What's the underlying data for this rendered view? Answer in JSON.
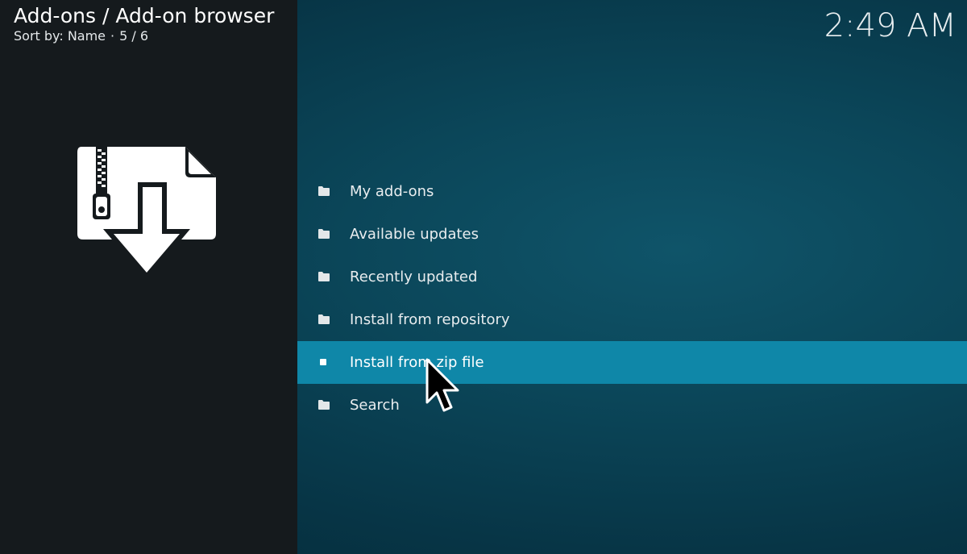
{
  "header": {
    "title": "Add-ons / Add-on browser",
    "sort_label": "Sort by: Name",
    "separator": "·",
    "position": "5 / 6"
  },
  "clock": "2:49 AM",
  "preview_icon": "zip-download-icon",
  "menu": {
    "items": [
      {
        "label": "My add-ons",
        "icon": "folder-icon",
        "focused": false
      },
      {
        "label": "Available updates",
        "icon": "folder-icon",
        "focused": false
      },
      {
        "label": "Recently updated",
        "icon": "folder-icon",
        "focused": false
      },
      {
        "label": "Install from repository",
        "icon": "folder-icon",
        "focused": false
      },
      {
        "label": "Install from zip file",
        "icon": "square-dot-icon",
        "focused": true
      },
      {
        "label": "Search",
        "icon": "folder-icon",
        "focused": false
      }
    ]
  },
  "colors": {
    "left_panel": "#151a1d",
    "background": "#0b4659",
    "focus_highlight": "#0f87a8",
    "text": "#e9edef"
  }
}
